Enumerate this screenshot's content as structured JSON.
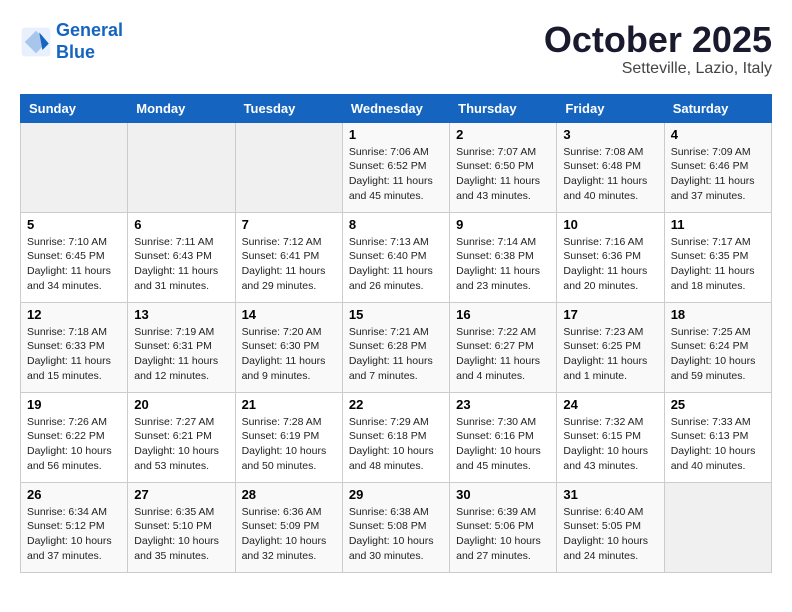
{
  "header": {
    "logo_line1": "General",
    "logo_line2": "Blue",
    "title": "October 2025",
    "subtitle": "Setteville, Lazio, Italy"
  },
  "weekdays": [
    "Sunday",
    "Monday",
    "Tuesday",
    "Wednesday",
    "Thursday",
    "Friday",
    "Saturday"
  ],
  "weeks": [
    [
      {
        "day": "",
        "info": ""
      },
      {
        "day": "",
        "info": ""
      },
      {
        "day": "",
        "info": ""
      },
      {
        "day": "1",
        "info": "Sunrise: 7:06 AM\nSunset: 6:52 PM\nDaylight: 11 hours and 45 minutes."
      },
      {
        "day": "2",
        "info": "Sunrise: 7:07 AM\nSunset: 6:50 PM\nDaylight: 11 hours and 43 minutes."
      },
      {
        "day": "3",
        "info": "Sunrise: 7:08 AM\nSunset: 6:48 PM\nDaylight: 11 hours and 40 minutes."
      },
      {
        "day": "4",
        "info": "Sunrise: 7:09 AM\nSunset: 6:46 PM\nDaylight: 11 hours and 37 minutes."
      }
    ],
    [
      {
        "day": "5",
        "info": "Sunrise: 7:10 AM\nSunset: 6:45 PM\nDaylight: 11 hours and 34 minutes."
      },
      {
        "day": "6",
        "info": "Sunrise: 7:11 AM\nSunset: 6:43 PM\nDaylight: 11 hours and 31 minutes."
      },
      {
        "day": "7",
        "info": "Sunrise: 7:12 AM\nSunset: 6:41 PM\nDaylight: 11 hours and 29 minutes."
      },
      {
        "day": "8",
        "info": "Sunrise: 7:13 AM\nSunset: 6:40 PM\nDaylight: 11 hours and 26 minutes."
      },
      {
        "day": "9",
        "info": "Sunrise: 7:14 AM\nSunset: 6:38 PM\nDaylight: 11 hours and 23 minutes."
      },
      {
        "day": "10",
        "info": "Sunrise: 7:16 AM\nSunset: 6:36 PM\nDaylight: 11 hours and 20 minutes."
      },
      {
        "day": "11",
        "info": "Sunrise: 7:17 AM\nSunset: 6:35 PM\nDaylight: 11 hours and 18 minutes."
      }
    ],
    [
      {
        "day": "12",
        "info": "Sunrise: 7:18 AM\nSunset: 6:33 PM\nDaylight: 11 hours and 15 minutes."
      },
      {
        "day": "13",
        "info": "Sunrise: 7:19 AM\nSunset: 6:31 PM\nDaylight: 11 hours and 12 minutes."
      },
      {
        "day": "14",
        "info": "Sunrise: 7:20 AM\nSunset: 6:30 PM\nDaylight: 11 hours and 9 minutes."
      },
      {
        "day": "15",
        "info": "Sunrise: 7:21 AM\nSunset: 6:28 PM\nDaylight: 11 hours and 7 minutes."
      },
      {
        "day": "16",
        "info": "Sunrise: 7:22 AM\nSunset: 6:27 PM\nDaylight: 11 hours and 4 minutes."
      },
      {
        "day": "17",
        "info": "Sunrise: 7:23 AM\nSunset: 6:25 PM\nDaylight: 11 hours and 1 minute."
      },
      {
        "day": "18",
        "info": "Sunrise: 7:25 AM\nSunset: 6:24 PM\nDaylight: 10 hours and 59 minutes."
      }
    ],
    [
      {
        "day": "19",
        "info": "Sunrise: 7:26 AM\nSunset: 6:22 PM\nDaylight: 10 hours and 56 minutes."
      },
      {
        "day": "20",
        "info": "Sunrise: 7:27 AM\nSunset: 6:21 PM\nDaylight: 10 hours and 53 minutes."
      },
      {
        "day": "21",
        "info": "Sunrise: 7:28 AM\nSunset: 6:19 PM\nDaylight: 10 hours and 50 minutes."
      },
      {
        "day": "22",
        "info": "Sunrise: 7:29 AM\nSunset: 6:18 PM\nDaylight: 10 hours and 48 minutes."
      },
      {
        "day": "23",
        "info": "Sunrise: 7:30 AM\nSunset: 6:16 PM\nDaylight: 10 hours and 45 minutes."
      },
      {
        "day": "24",
        "info": "Sunrise: 7:32 AM\nSunset: 6:15 PM\nDaylight: 10 hours and 43 minutes."
      },
      {
        "day": "25",
        "info": "Sunrise: 7:33 AM\nSunset: 6:13 PM\nDaylight: 10 hours and 40 minutes."
      }
    ],
    [
      {
        "day": "26",
        "info": "Sunrise: 6:34 AM\nSunset: 5:12 PM\nDaylight: 10 hours and 37 minutes."
      },
      {
        "day": "27",
        "info": "Sunrise: 6:35 AM\nSunset: 5:10 PM\nDaylight: 10 hours and 35 minutes."
      },
      {
        "day": "28",
        "info": "Sunrise: 6:36 AM\nSunset: 5:09 PM\nDaylight: 10 hours and 32 minutes."
      },
      {
        "day": "29",
        "info": "Sunrise: 6:38 AM\nSunset: 5:08 PM\nDaylight: 10 hours and 30 minutes."
      },
      {
        "day": "30",
        "info": "Sunrise: 6:39 AM\nSunset: 5:06 PM\nDaylight: 10 hours and 27 minutes."
      },
      {
        "day": "31",
        "info": "Sunrise: 6:40 AM\nSunset: 5:05 PM\nDaylight: 10 hours and 24 minutes."
      },
      {
        "day": "",
        "info": ""
      }
    ]
  ]
}
